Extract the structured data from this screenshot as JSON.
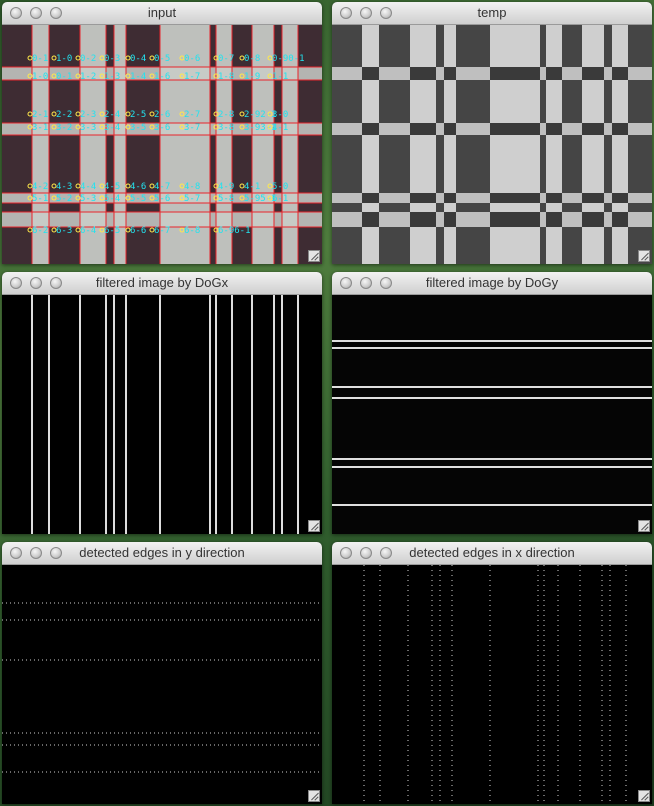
{
  "windows": [
    {
      "id": "input",
      "title": "input"
    },
    {
      "id": "temp",
      "title": "temp"
    },
    {
      "id": "dogx",
      "title": "filtered image by DoGx"
    },
    {
      "id": "dogy",
      "title": "filtered image by DoGy"
    },
    {
      "id": "edges-y",
      "title": "detected edges in y direction"
    },
    {
      "id": "edges-x",
      "title": "detected edges in x direction"
    }
  ],
  "input_labels": [
    "0-1",
    "1-0",
    "0-2",
    "0-3",
    "0-4",
    "0-5",
    "0-6",
    "0-7",
    "0-8",
    "0-90-1",
    "1-0",
    "0-1",
    "1-2",
    "1-3",
    "1-4",
    "1-6",
    "1-7",
    "1-8",
    "1-9",
    "1-1",
    "2-1",
    "2-2",
    "2-3",
    "2-4",
    "2-5",
    "2-6",
    "2-7",
    "2-8",
    "2-92-1",
    "3-0",
    "3-1",
    "3-2",
    "3-3",
    "3-4",
    "3-5",
    "3-6",
    "3-7",
    "3-8",
    "3-93-1",
    "4-1",
    "4-2",
    "4-3",
    "4-4",
    "4-5",
    "4-6",
    "4-7",
    "4-8",
    "4-9",
    "4-1",
    "5-0",
    "5-1",
    "5-2",
    "5-3",
    "5-4",
    "5-5",
    "5-6",
    "5-7",
    "5-8",
    "5-95-1",
    "6-1",
    "6-2",
    "6-3",
    "6-4",
    "6-5",
    "6-6",
    "6-7",
    "6-8",
    "6-96-1"
  ],
  "colors": {
    "grid_line": "#e8252b",
    "label_text": "#22e2ee",
    "light_stripe": "#c9cdc8",
    "dark_fabric": "#3e2c33"
  }
}
